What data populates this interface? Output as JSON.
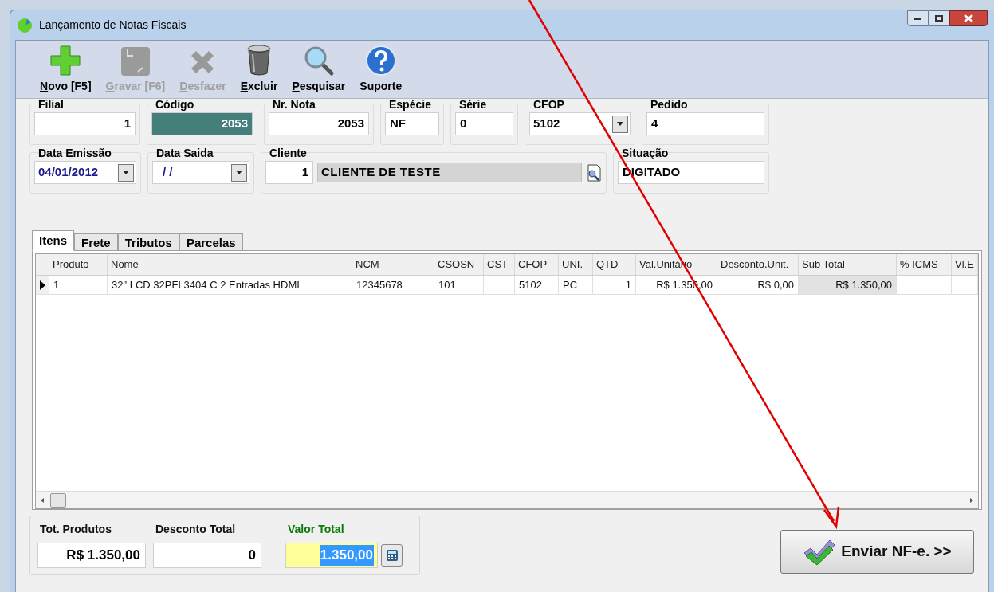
{
  "window": {
    "title": "Lançamento de Notas Fiscais"
  },
  "toolbar": {
    "buttons": [
      {
        "label": "Novo [F5]",
        "disabled": false,
        "mnemonic": true
      },
      {
        "label": "Gravar [F6]",
        "disabled": true,
        "mnemonic": true
      },
      {
        "label": "Desfazer",
        "disabled": true,
        "mnemonic": true
      },
      {
        "label": "Excluir",
        "disabled": false,
        "mnemonic": true
      },
      {
        "label": "Pesquisar",
        "disabled": false,
        "mnemonic": true
      },
      {
        "label": "Suporte",
        "disabled": false,
        "mnemonic": false
      }
    ]
  },
  "header_rows": [
    [
      {
        "label": "Filial",
        "kind": "text",
        "value": "1",
        "highlighted": false
      },
      {
        "label": "Código",
        "kind": "text",
        "value": "2053",
        "highlighted": true
      },
      {
        "label": "Nr. Nota",
        "kind": "text",
        "value": "2053",
        "highlighted": false
      },
      {
        "label": "Espécie",
        "kind": "text",
        "value": "NF",
        "highlighted": false
      },
      {
        "label": "Série",
        "kind": "text",
        "value": "0",
        "highlighted": false
      },
      {
        "label": "CFOP",
        "kind": "dropdown",
        "value": "5102"
      },
      {
        "label": "Pedido",
        "kind": "text",
        "value": "4",
        "highlighted": false
      }
    ],
    [
      {
        "label": "Data Emissão",
        "kind": "date",
        "value": "04/01/2012"
      },
      {
        "label": "Data Saida",
        "kind": "date",
        "value": "/ /"
      },
      {
        "label": "Cliente",
        "kind": "client",
        "value": "1",
        "name": "CLIENTE DE TESTE"
      },
      {
        "label": "Situação",
        "kind": "text",
        "value": "DIGITADO",
        "highlighted": false
      }
    ]
  ],
  "tabs": [
    {
      "label": "Itens",
      "selected": true
    },
    {
      "label": "Frete",
      "selected": false
    },
    {
      "label": "Tributos",
      "selected": false
    },
    {
      "label": "Parcelas",
      "selected": false
    }
  ],
  "table": {
    "columns": [
      "Produto",
      "Nome",
      "NCM",
      "CSOSN",
      "CST",
      "CFOP",
      "UNI.",
      "QTD",
      "Val.Unitário",
      "Desconto.Unit.",
      "Sub Total",
      "% ICMS",
      "Vl.E"
    ],
    "rows": [
      {
        "current": true,
        "cells": [
          "1",
          "32\" LCD 32PFL3404 C 2 Entradas HDMI",
          "12345678",
          "101",
          "",
          "5102",
          "PC",
          "1",
          "R$ 1.350,00",
          "R$ 0,00",
          "R$ 1.350,00",
          "",
          ""
        ]
      }
    ]
  },
  "totals": [
    {
      "label": "Tot. Produtos",
      "value": "R$ 1.350,00",
      "kind": "plain"
    },
    {
      "label": "Desconto Total",
      "value": "0",
      "kind": "plain"
    },
    {
      "label": "Valor Total",
      "value": "1.350,00",
      "kind": "calc"
    }
  ],
  "send_button": {
    "label": "Enviar NF-e. >>"
  }
}
